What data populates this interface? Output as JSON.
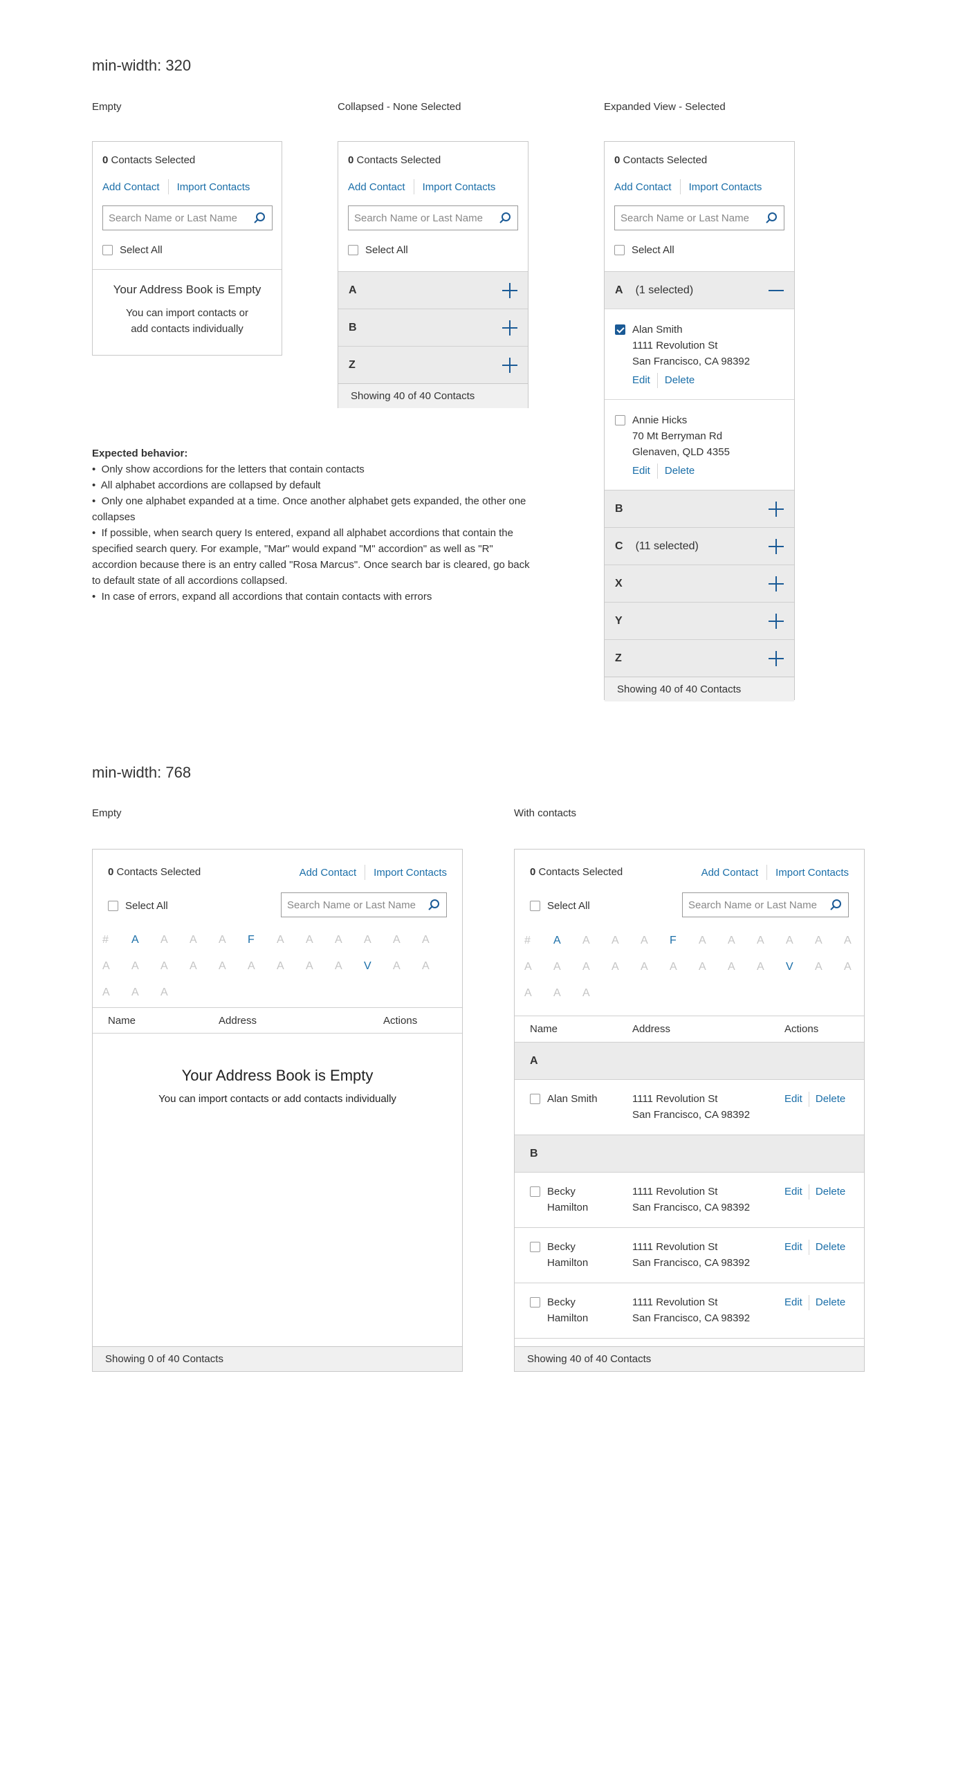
{
  "section_mobile": {
    "title": "min-width: 320",
    "variants": {
      "empty": "Empty",
      "collapsed": "Collapsed - None Selected",
      "expanded": "Expanded View - Selected"
    }
  },
  "common": {
    "selected_count": "0",
    "selected_label": " Contacts Selected",
    "add_contact": "Add Contact",
    "import_contacts": "Import Contacts",
    "search_placeholder": "Search Name or Last Name",
    "select_all": "Select All",
    "edit": "Edit",
    "delete": "Delete"
  },
  "mobile_empty": {
    "empty_title": "Your Address Book is Empty",
    "empty_line1": "You can import contacts or",
    "empty_line2": "add contacts individually"
  },
  "mobile_collapsed": {
    "accordions": [
      {
        "letter": "A"
      },
      {
        "letter": "B"
      },
      {
        "letter": "Z"
      }
    ],
    "footer": "Showing 40 of 40 Contacts"
  },
  "mobile_expanded": {
    "expanded_group": {
      "letter": "A",
      "count": "(1 selected)"
    },
    "contacts": [
      {
        "name": "Alan Smith",
        "line1": "1111 Revolution St",
        "line2": "San Francisco, CA 98392",
        "checked": true
      },
      {
        "name": "Annie Hicks",
        "line1": "70 Mt Berryman Rd",
        "line2": "Glenaven, QLD 4355",
        "checked": false
      }
    ],
    "collapsed_groups": [
      {
        "letter": "B",
        "count": ""
      },
      {
        "letter": "C",
        "count": "(11 selected)"
      },
      {
        "letter": "X",
        "count": ""
      },
      {
        "letter": "Y",
        "count": ""
      },
      {
        "letter": "Z",
        "count": ""
      }
    ],
    "footer": "Showing 40 of 40 Contacts"
  },
  "notes": {
    "heading": "Expected behavior:",
    "items": [
      "Only show accordions for the letters that contain contacts",
      "All alphabet accordions are collapsed by default",
      "Only one alphabet expanded at a time. Once another alphabet gets expanded, the other one collapses",
      "If possible, when search query Is entered, expand all alphabet accordions that contain the specified search query. For example, \"Mar\" would expand \"M\" accordion\" as well as \"R\" accordion because there is an entry called \"Rosa Marcus\". Once search bar is cleared, go back to default state of all accordions collapsed.",
      "In case of errors, expand all accordions that contain contacts with errors"
    ]
  },
  "section_tablet": {
    "title": "min-width: 768",
    "variants": {
      "empty": "Empty",
      "with_contacts": "With contacts"
    }
  },
  "alphabet": [
    {
      "ch": "#",
      "active": false
    },
    {
      "ch": "A",
      "active": true
    },
    {
      "ch": "A",
      "active": false
    },
    {
      "ch": "A",
      "active": false
    },
    {
      "ch": "A",
      "active": false
    },
    {
      "ch": "F",
      "active": true
    },
    {
      "ch": "A",
      "active": false
    },
    {
      "ch": "A",
      "active": false
    },
    {
      "ch": "A",
      "active": false
    },
    {
      "ch": "A",
      "active": false
    },
    {
      "ch": "A",
      "active": false
    },
    {
      "ch": "A",
      "active": false
    },
    {
      "ch": "A",
      "active": false
    },
    {
      "ch": "A",
      "active": false
    },
    {
      "ch": "A",
      "active": false
    },
    {
      "ch": "A",
      "active": false
    },
    {
      "ch": "A",
      "active": false
    },
    {
      "ch": "A",
      "active": false
    },
    {
      "ch": "A",
      "active": false
    },
    {
      "ch": "A",
      "active": false
    },
    {
      "ch": "A",
      "active": false
    },
    {
      "ch": "V",
      "active": true
    },
    {
      "ch": "A",
      "active": false
    },
    {
      "ch": "A",
      "active": false
    },
    {
      "ch": "A",
      "active": false
    },
    {
      "ch": "A",
      "active": false
    },
    {
      "ch": "A",
      "active": false
    }
  ],
  "table_headers": {
    "name": "Name",
    "address": "Address",
    "actions": "Actions"
  },
  "tablet_empty": {
    "empty_title": "Your Address Book is Empty",
    "empty_sub": "You can import contacts or add contacts individually",
    "footer": "Showing 0 of 40 Contacts"
  },
  "tablet_contacts": {
    "groups": [
      {
        "letter": "A",
        "rows": [
          {
            "name": "Alan Smith",
            "line1": "1111 Revolution St",
            "line2": "San Francisco, CA 98392"
          }
        ]
      },
      {
        "letter": "B",
        "rows": [
          {
            "name": "Becky Hamilton",
            "line1": "1111 Revolution St",
            "line2": "San Francisco, CA 98392"
          },
          {
            "name": "Becky Hamilton",
            "line1": "1111 Revolution St",
            "line2": "San Francisco, CA 98392"
          },
          {
            "name": "Becky Hamilton",
            "line1": "1111 Revolution St",
            "line2": "San Francisco, CA 98392"
          }
        ]
      }
    ],
    "footer": "Showing 40 of 40 Contacts"
  },
  "colors": {
    "link": "#1a6ea8",
    "accent": "#1a5a96",
    "accordion_bg": "#ebebeb",
    "footer_bg": "#f0f0f0",
    "border": "#c8c8c8",
    "inactive_letter": "#c4c4c4"
  }
}
